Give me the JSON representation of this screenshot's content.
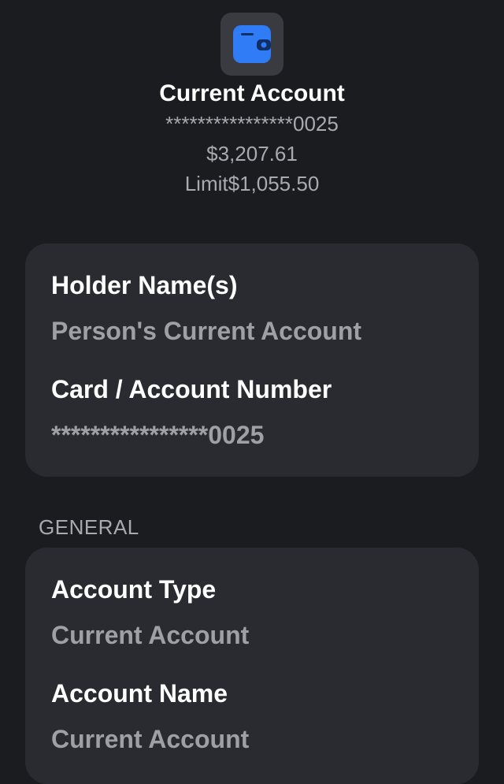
{
  "header": {
    "icon": "wallet-icon",
    "title": "Current Account",
    "masked_number": "****************0025",
    "balance": "$3,207.61",
    "limit": "Limit$1,055.50"
  },
  "details": {
    "holder_label": "Holder Name(s)",
    "holder_value": "Person's Current Account",
    "number_label": "Card / Account Number",
    "number_value": "****************0025"
  },
  "general": {
    "section_title": "GENERAL",
    "type_label": "Account Type",
    "type_value": "Current Account",
    "name_label": "Account Name",
    "name_value": "Current Account"
  },
  "colors": {
    "background": "#1b1c1f",
    "card": "#2a2b30",
    "icon_accent": "#2f7cf6"
  }
}
